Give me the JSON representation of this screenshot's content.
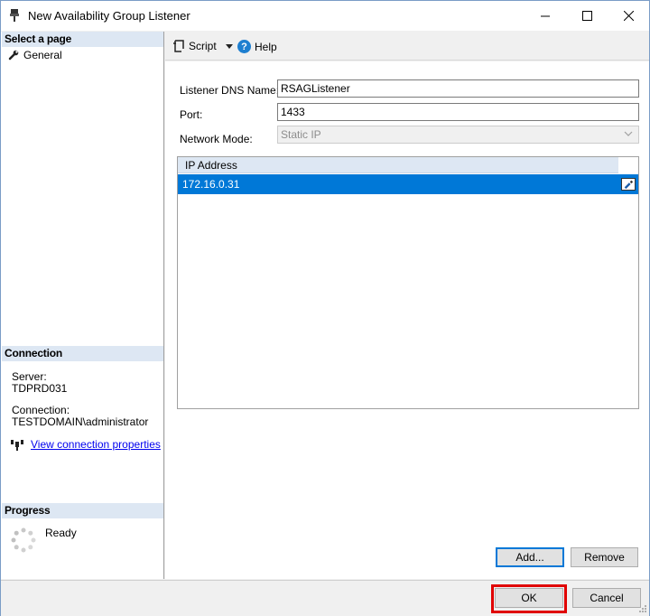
{
  "window": {
    "title": "New Availability Group Listener",
    "minimize_label": "—",
    "maximize_label": "☐",
    "close_label": "✕"
  },
  "leftpane": {
    "select_page_header": "Select a page",
    "pages": [
      {
        "label": "General",
        "icon": "wrench-icon"
      }
    ],
    "connection_header": "Connection",
    "server_label": "Server:",
    "server_value": "TDPRD031",
    "connection_label": "Connection:",
    "connection_value": "TESTDOMAIN\\administrator",
    "view_connection_link": "View connection properties",
    "progress_header": "Progress",
    "progress_status": "Ready"
  },
  "toolbar": {
    "script_label": "Script",
    "help_label": "Help"
  },
  "form": {
    "dns_label": "Listener DNS Name:",
    "dns_value": "RSAGListener",
    "port_label": "Port:",
    "port_value": "1433",
    "network_mode_label": "Network Mode:",
    "network_mode_value": "Static IP"
  },
  "grid": {
    "column_header": "IP Address",
    "rows": [
      {
        "ip": "172.16.0.31"
      }
    ]
  },
  "buttons": {
    "add": "Add...",
    "remove": "Remove",
    "ok": "OK",
    "cancel": "Cancel"
  },
  "colors": {
    "selection": "#0078d7",
    "section_header": "#dde7f3",
    "highlight": "#e00000",
    "link": "#0000ee"
  }
}
